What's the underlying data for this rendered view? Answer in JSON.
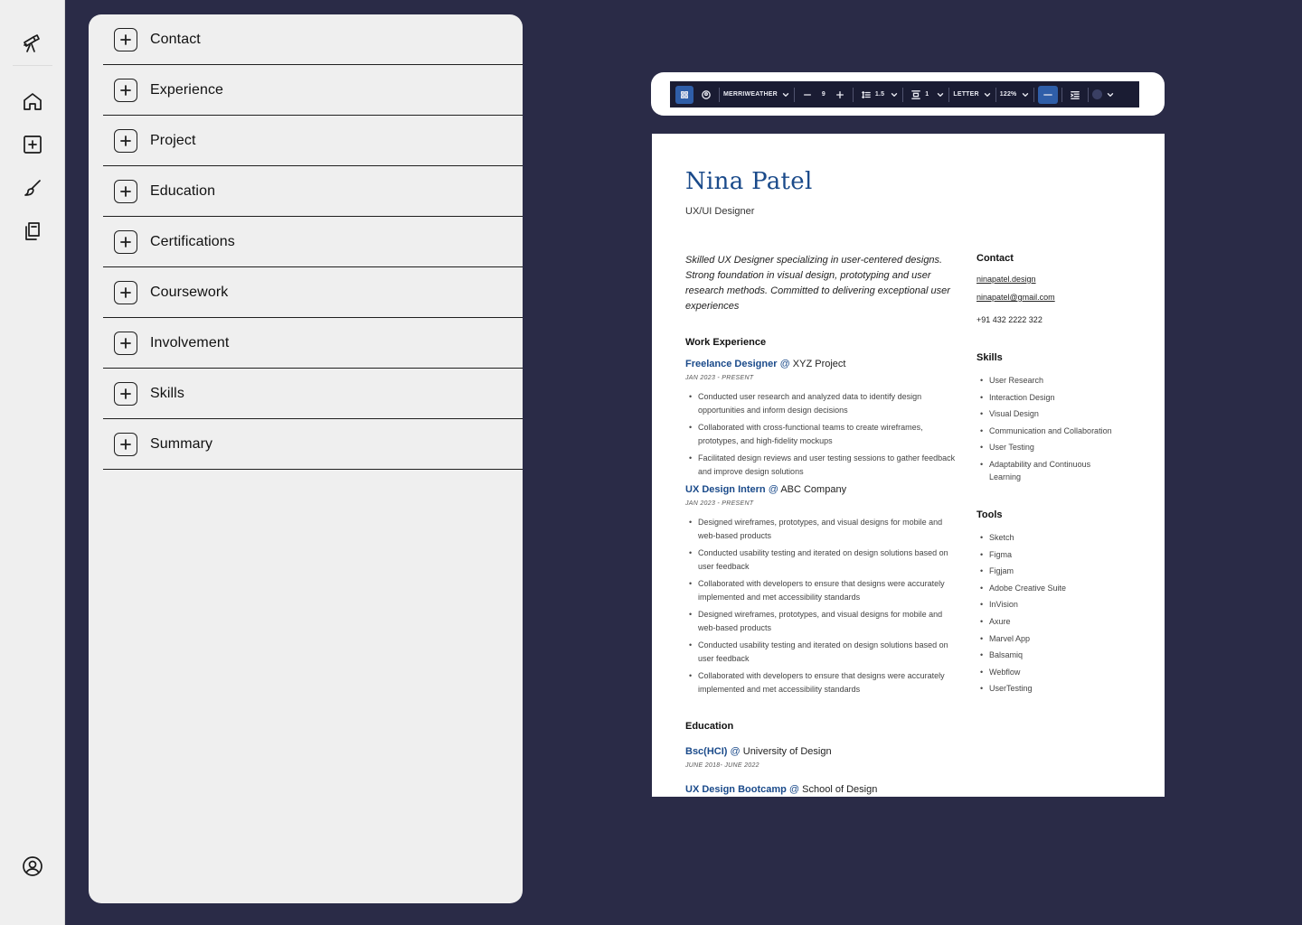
{
  "sections": [
    "Contact",
    "Experience",
    "Project",
    "Education",
    "Certifications",
    "Coursework",
    "Involvement",
    "Skills",
    "Summary"
  ],
  "toolbar": {
    "font": "MERRIWEATHER",
    "font_size": "9",
    "line_spacing": "1.5",
    "margin": "1",
    "page_size": "LETTER",
    "zoom": "122%"
  },
  "resume": {
    "name": "Nina Patel",
    "role": "UX/UI Designer",
    "summary": "Skilled UX Designer specializing in user-centered designs. Strong foundation in visual design, prototyping and user research methods. Committed to delivering exceptional user experiences",
    "work_heading": "Work Experience",
    "jobs": [
      {
        "title": "Freelance Designer",
        "at": "@",
        "company": "XYZ Project",
        "date": "JAN 2023 - PRESENT",
        "bullets": [
          "Conducted user research and analyzed data to identify design opportunities and inform design decisions",
          "Collaborated with cross-functional teams to create wireframes, prototypes, and high-fidelity mockups",
          "Facilitated design reviews and user testing sessions to gather feedback and improve design solutions"
        ]
      },
      {
        "title": "UX Design Intern",
        "at": "@",
        "company": "ABC Company",
        "date": "JAN 2023 - PRESENT",
        "bullets": [
          "Designed wireframes, prototypes, and visual designs for mobile and web-based products",
          "Conducted usability testing and iterated on design solutions based on user feedback",
          "Collaborated with developers to ensure that designs were accurately implemented and met accessibility standards",
          "Designed wireframes, prototypes, and visual designs for mobile and web-based products",
          "Conducted usability testing and iterated on design solutions based on user feedback",
          "Collaborated with developers to ensure that designs were accurately implemented and met accessibility standards"
        ]
      }
    ],
    "education_heading": "Education",
    "education": [
      {
        "title": "Bsc(HCI)",
        "at": "@",
        "school": "University of Design",
        "date": "JUNE 2018- JUNE 2022"
      },
      {
        "title": "UX Design Bootcamp",
        "at": "@",
        "school": "School of Design"
      }
    ],
    "contact_heading": "Contact",
    "contact": {
      "website": "ninapatel.design",
      "email": "ninapatel@gmail.com",
      "phone": "+91 432 2222 322"
    },
    "skills_heading": "Skills",
    "skills": [
      "User Research",
      "Interaction Design",
      "Visual Design",
      "Communication and Collaboration",
      "User Testing",
      "Adaptability and Continuous Learning"
    ],
    "tools_heading": "Tools",
    "tools": [
      "Sketch",
      "Figma",
      "Figjam",
      "Adobe Creative Suite",
      "InVision",
      "Axure",
      "Marvel App",
      "Balsamiq",
      "Webflow",
      "UserTesting"
    ]
  }
}
